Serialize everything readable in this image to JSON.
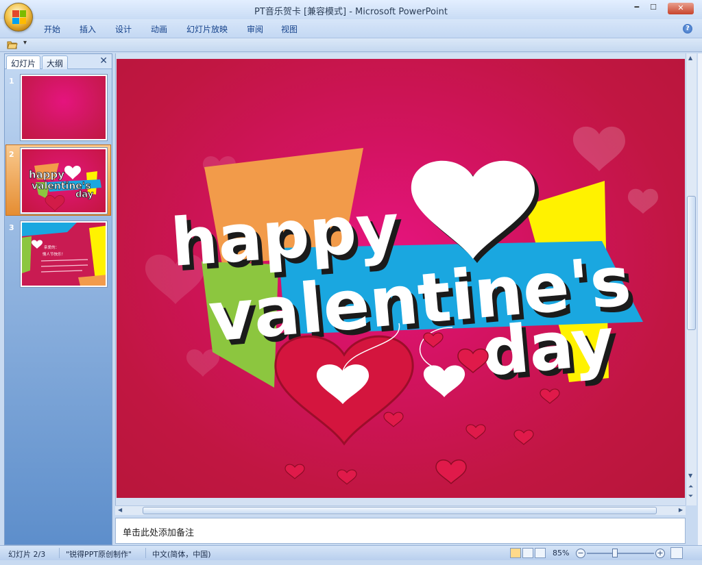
{
  "window": {
    "title": "PT音乐贺卡 [兼容模式] - Microsoft PowerPoint",
    "controls": [
      "minimize",
      "maximize",
      "close"
    ]
  },
  "ribbon": {
    "tabs": [
      "开始",
      "插入",
      "设计",
      "动画",
      "幻灯片放映",
      "审阅",
      "视图"
    ]
  },
  "left_pane": {
    "tabs": [
      "幻灯片",
      "大纲"
    ],
    "slides": [
      {
        "number": "1",
        "selected": false
      },
      {
        "number": "2",
        "selected": true
      },
      {
        "number": "3",
        "selected": false
      }
    ]
  },
  "slide": {
    "line1": "happy",
    "line2": "valentine's",
    "line3": "day",
    "colors": {
      "background": "#c8164a",
      "orange": "#f29b4a",
      "green": "#8cc63f",
      "yellow": "#fff200",
      "blue": "#1aa7e0"
    }
  },
  "thumb3": {
    "greeting": "亲爱的：",
    "line": "情人节快乐！"
  },
  "notes": {
    "placeholder": "单击此处添加备注"
  },
  "status": {
    "slide_indicator": "幻灯片 2/3",
    "theme": "\"锐得PPT原创制作\"",
    "language": "中文(简体，中国)",
    "zoom": "85%"
  },
  "icons": [
    "office-logo-icon",
    "open-folder-icon",
    "help-icon",
    "pane-close-icon",
    "normal-view-icon",
    "slide-sorter-icon",
    "slideshow-icon",
    "zoom-out-icon",
    "zoom-in-icon",
    "fit-window-icon"
  ]
}
